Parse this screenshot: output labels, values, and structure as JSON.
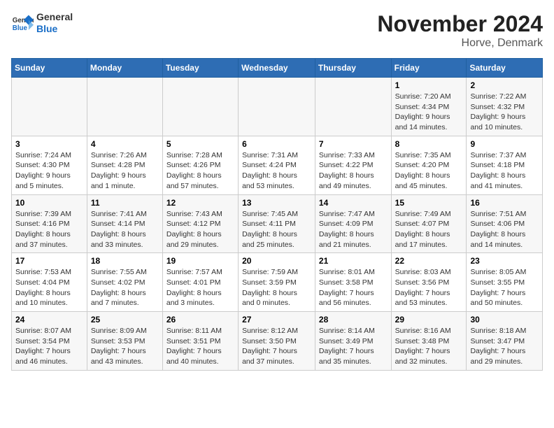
{
  "header": {
    "logo_line1": "General",
    "logo_line2": "Blue",
    "title": "November 2024",
    "subtitle": "Horve, Denmark"
  },
  "weekdays": [
    "Sunday",
    "Monday",
    "Tuesday",
    "Wednesday",
    "Thursday",
    "Friday",
    "Saturday"
  ],
  "weeks": [
    [
      {
        "day": "",
        "info": ""
      },
      {
        "day": "",
        "info": ""
      },
      {
        "day": "",
        "info": ""
      },
      {
        "day": "",
        "info": ""
      },
      {
        "day": "",
        "info": ""
      },
      {
        "day": "1",
        "info": "Sunrise: 7:20 AM\nSunset: 4:34 PM\nDaylight: 9 hours and 14 minutes."
      },
      {
        "day": "2",
        "info": "Sunrise: 7:22 AM\nSunset: 4:32 PM\nDaylight: 9 hours and 10 minutes."
      }
    ],
    [
      {
        "day": "3",
        "info": "Sunrise: 7:24 AM\nSunset: 4:30 PM\nDaylight: 9 hours and 5 minutes."
      },
      {
        "day": "4",
        "info": "Sunrise: 7:26 AM\nSunset: 4:28 PM\nDaylight: 9 hours and 1 minute."
      },
      {
        "day": "5",
        "info": "Sunrise: 7:28 AM\nSunset: 4:26 PM\nDaylight: 8 hours and 57 minutes."
      },
      {
        "day": "6",
        "info": "Sunrise: 7:31 AM\nSunset: 4:24 PM\nDaylight: 8 hours and 53 minutes."
      },
      {
        "day": "7",
        "info": "Sunrise: 7:33 AM\nSunset: 4:22 PM\nDaylight: 8 hours and 49 minutes."
      },
      {
        "day": "8",
        "info": "Sunrise: 7:35 AM\nSunset: 4:20 PM\nDaylight: 8 hours and 45 minutes."
      },
      {
        "day": "9",
        "info": "Sunrise: 7:37 AM\nSunset: 4:18 PM\nDaylight: 8 hours and 41 minutes."
      }
    ],
    [
      {
        "day": "10",
        "info": "Sunrise: 7:39 AM\nSunset: 4:16 PM\nDaylight: 8 hours and 37 minutes."
      },
      {
        "day": "11",
        "info": "Sunrise: 7:41 AM\nSunset: 4:14 PM\nDaylight: 8 hours and 33 minutes."
      },
      {
        "day": "12",
        "info": "Sunrise: 7:43 AM\nSunset: 4:12 PM\nDaylight: 8 hours and 29 minutes."
      },
      {
        "day": "13",
        "info": "Sunrise: 7:45 AM\nSunset: 4:11 PM\nDaylight: 8 hours and 25 minutes."
      },
      {
        "day": "14",
        "info": "Sunrise: 7:47 AM\nSunset: 4:09 PM\nDaylight: 8 hours and 21 minutes."
      },
      {
        "day": "15",
        "info": "Sunrise: 7:49 AM\nSunset: 4:07 PM\nDaylight: 8 hours and 17 minutes."
      },
      {
        "day": "16",
        "info": "Sunrise: 7:51 AM\nSunset: 4:06 PM\nDaylight: 8 hours and 14 minutes."
      }
    ],
    [
      {
        "day": "17",
        "info": "Sunrise: 7:53 AM\nSunset: 4:04 PM\nDaylight: 8 hours and 10 minutes."
      },
      {
        "day": "18",
        "info": "Sunrise: 7:55 AM\nSunset: 4:02 PM\nDaylight: 8 hours and 7 minutes."
      },
      {
        "day": "19",
        "info": "Sunrise: 7:57 AM\nSunset: 4:01 PM\nDaylight: 8 hours and 3 minutes."
      },
      {
        "day": "20",
        "info": "Sunrise: 7:59 AM\nSunset: 3:59 PM\nDaylight: 8 hours and 0 minutes."
      },
      {
        "day": "21",
        "info": "Sunrise: 8:01 AM\nSunset: 3:58 PM\nDaylight: 7 hours and 56 minutes."
      },
      {
        "day": "22",
        "info": "Sunrise: 8:03 AM\nSunset: 3:56 PM\nDaylight: 7 hours and 53 minutes."
      },
      {
        "day": "23",
        "info": "Sunrise: 8:05 AM\nSunset: 3:55 PM\nDaylight: 7 hours and 50 minutes."
      }
    ],
    [
      {
        "day": "24",
        "info": "Sunrise: 8:07 AM\nSunset: 3:54 PM\nDaylight: 7 hours and 46 minutes."
      },
      {
        "day": "25",
        "info": "Sunrise: 8:09 AM\nSunset: 3:53 PM\nDaylight: 7 hours and 43 minutes."
      },
      {
        "day": "26",
        "info": "Sunrise: 8:11 AM\nSunset: 3:51 PM\nDaylight: 7 hours and 40 minutes."
      },
      {
        "day": "27",
        "info": "Sunrise: 8:12 AM\nSunset: 3:50 PM\nDaylight: 7 hours and 37 minutes."
      },
      {
        "day": "28",
        "info": "Sunrise: 8:14 AM\nSunset: 3:49 PM\nDaylight: 7 hours and 35 minutes."
      },
      {
        "day": "29",
        "info": "Sunrise: 8:16 AM\nSunset: 3:48 PM\nDaylight: 7 hours and 32 minutes."
      },
      {
        "day": "30",
        "info": "Sunrise: 8:18 AM\nSunset: 3:47 PM\nDaylight: 7 hours and 29 minutes."
      }
    ]
  ]
}
